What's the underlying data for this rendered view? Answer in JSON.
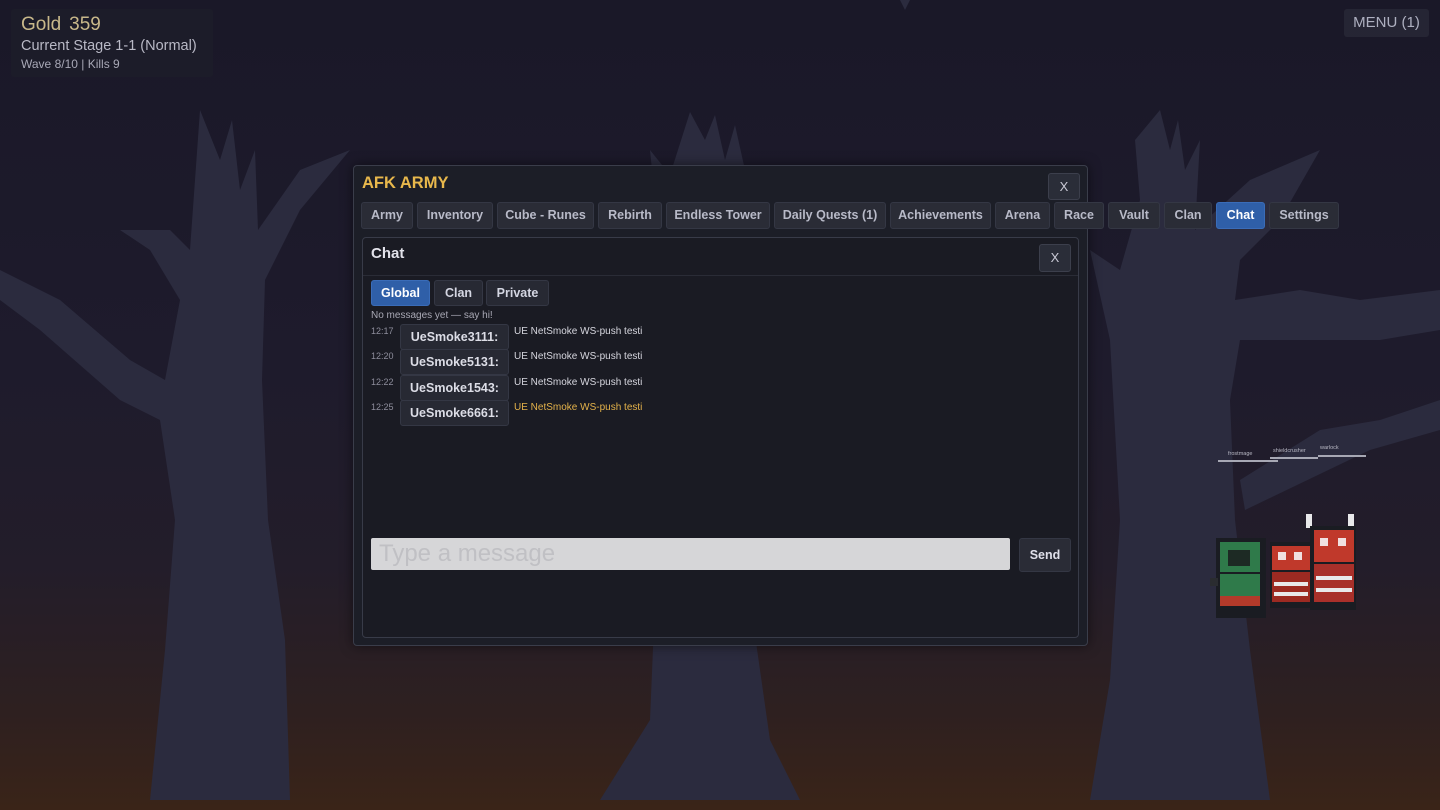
{
  "hud": {
    "gold_label": "Gold",
    "gold_value": "359",
    "stage_text": "Current Stage  1-1 (Normal)",
    "wave_text": "Wave 8/10  |  Kills 9"
  },
  "menu_button": {
    "label": "MENU (1)"
  },
  "window": {
    "title": "AFK ARMY",
    "close_label": "X",
    "tabs": [
      {
        "label": "Army"
      },
      {
        "label": "Inventory"
      },
      {
        "label": "Cube - Runes"
      },
      {
        "label": "Rebirth"
      },
      {
        "label": "Endless Tower"
      },
      {
        "label": "Daily Quests (1)"
      },
      {
        "label": "Achievements"
      },
      {
        "label": "Arena"
      },
      {
        "label": "Race"
      },
      {
        "label": "Vault"
      },
      {
        "label": "Clan"
      },
      {
        "label": "Chat",
        "active": true
      },
      {
        "label": "Settings"
      }
    ]
  },
  "chat": {
    "title": "Chat",
    "close_label": "X",
    "subtabs": [
      {
        "label": "Global",
        "active": true
      },
      {
        "label": "Clan"
      },
      {
        "label": "Private"
      }
    ],
    "empty_note": "No messages yet — say hi!",
    "messages": [
      {
        "time": "12:17",
        "user": "UeSmoke3111:",
        "text": "UE NetSmoke WS-push testi"
      },
      {
        "time": "12:20",
        "user": "UeSmoke5131:",
        "text": "UE NetSmoke WS-push testi"
      },
      {
        "time": "12:22",
        "user": "UeSmoke1543:",
        "text": "UE NetSmoke WS-push testi"
      },
      {
        "time": "12:25",
        "user": "UeSmoke6661:",
        "text": "UE NetSmoke WS-push testi"
      }
    ],
    "input_placeholder": "Type a message",
    "send_label": "Send"
  },
  "units": {
    "labels": [
      "frostmage",
      "shieldcrusher",
      "warlock"
    ]
  },
  "colors": {
    "title_accent": "#e8b84c",
    "active_tab": "#2f5fa8",
    "highlight_message": "#e4b24a"
  }
}
